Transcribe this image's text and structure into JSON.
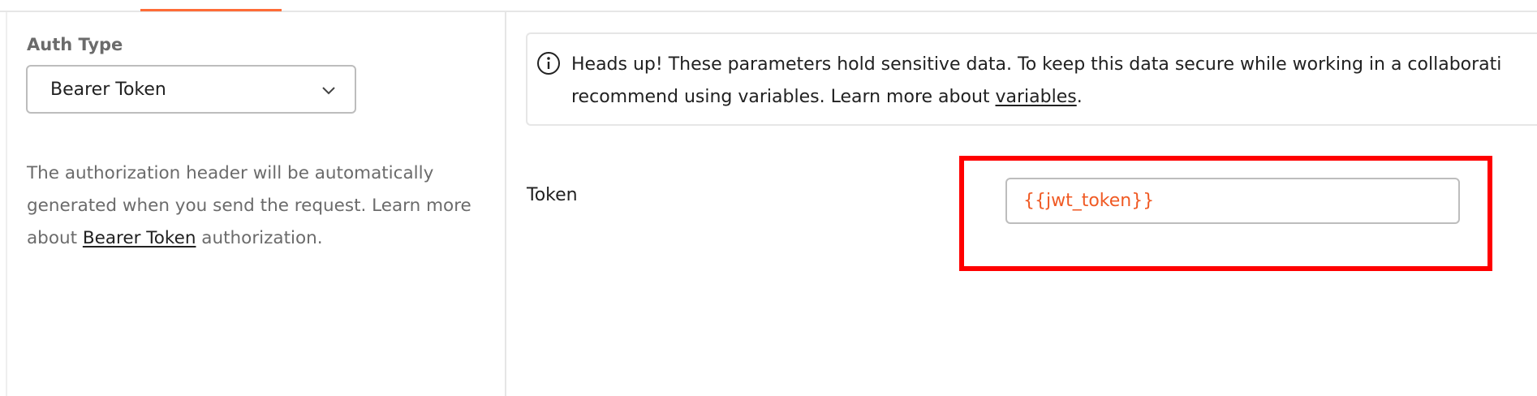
{
  "left_panel": {
    "auth_type_label": "Auth Type",
    "auth_type_selected": "Bearer Token",
    "description_part1": "The authorization header will be automatically generated when you send the request. Learn more about ",
    "description_link": "Bearer Token",
    "description_part2": " authorization."
  },
  "callout": {
    "icon": "info-icon",
    "text_part1": "Heads up! These parameters hold sensitive data. To keep this data secure while working in a collaborati",
    "text_part2": "recommend using variables. Learn more about ",
    "link": "variables",
    "text_part3": "."
  },
  "token_field": {
    "label": "Token",
    "value": "{{jwt_token}}"
  },
  "colors": {
    "accent": "#ff6c37",
    "variable_text": "#f05a24",
    "highlight": "#ff0000"
  }
}
